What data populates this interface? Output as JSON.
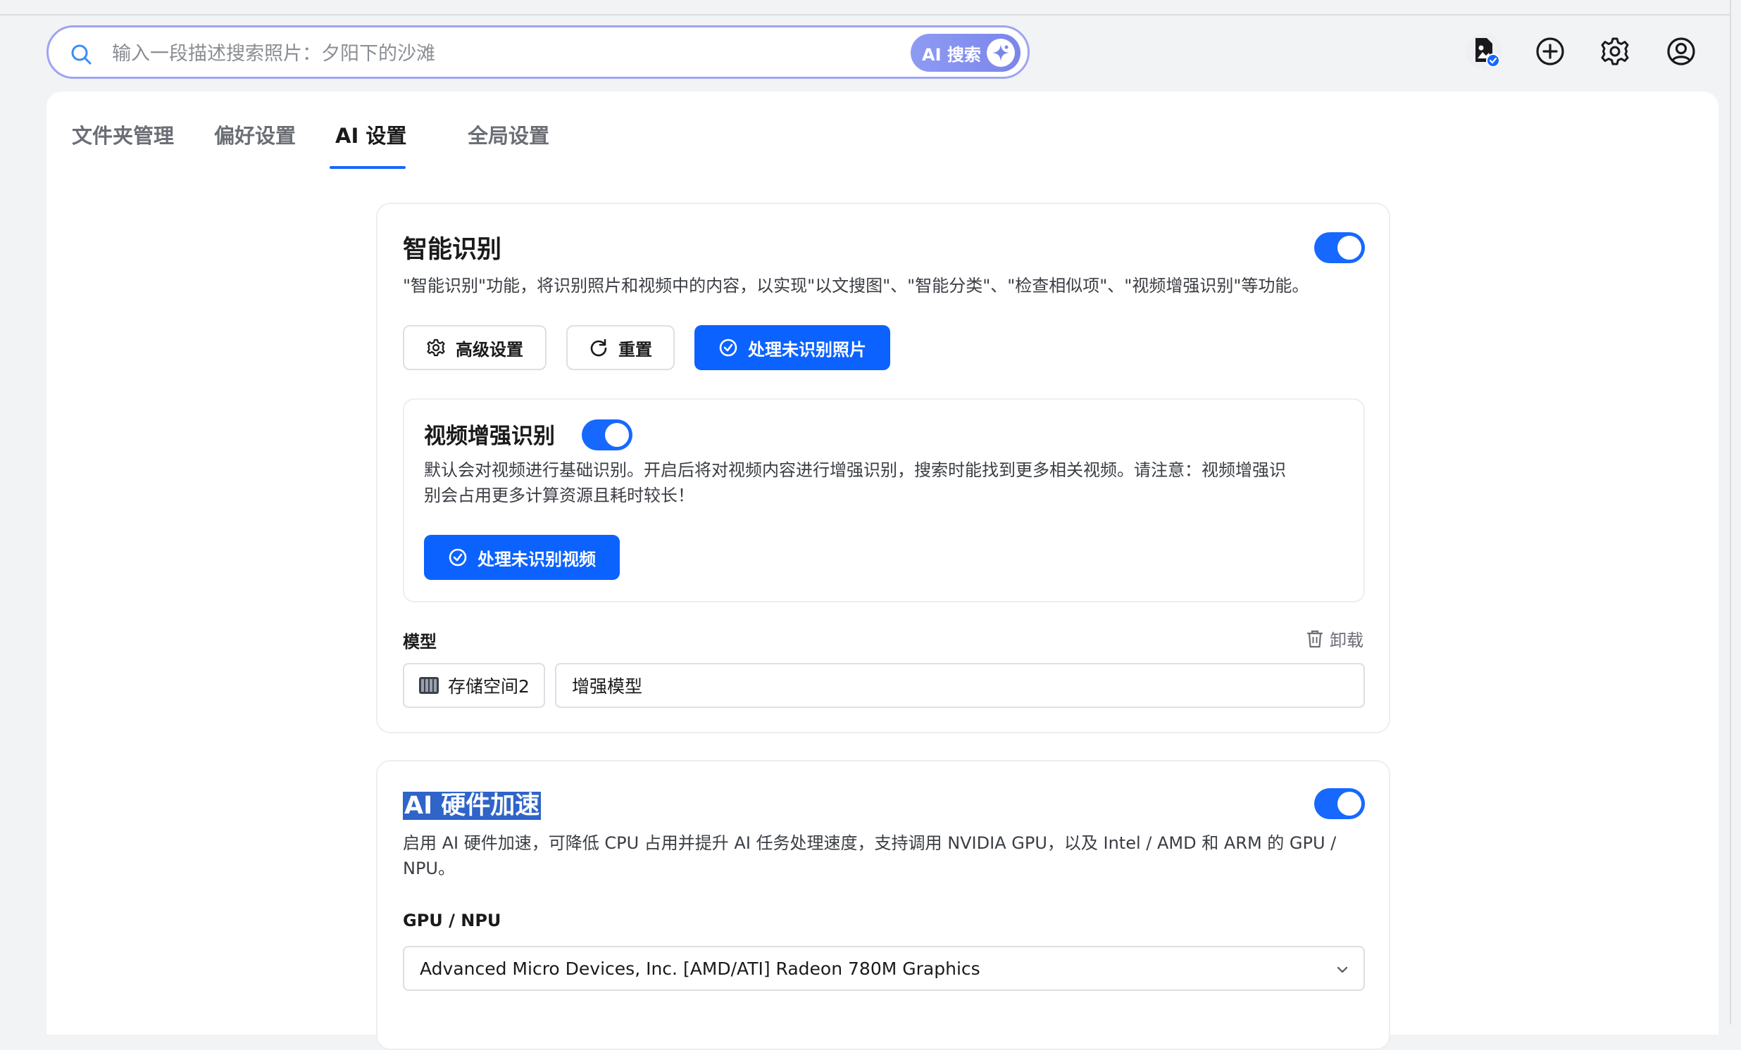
{
  "search": {
    "placeholder": "输入一段描述搜索照片：夕阳下的沙滩",
    "ai_button_label": "AI 搜索"
  },
  "topbar": {
    "icons": [
      "document-sync-icon",
      "add-circle-icon",
      "gear-icon",
      "user-avatar-icon"
    ],
    "accent": "#1668ff"
  },
  "tabs": [
    {
      "label": "文件夹管理",
      "active": false
    },
    {
      "label": "偏好设置",
      "active": false
    },
    {
      "label": "AI 设置",
      "active": true
    },
    {
      "label": "全局设置",
      "active": false
    }
  ],
  "smart_recognition": {
    "title": "智能识别",
    "enabled": true,
    "description": "\"智能识别\"功能，将识别照片和视频中的内容，以实现\"以文搜图\"、\"智能分类\"、\"检查相似项\"、\"视频增强识别\"等功能。",
    "advanced_button": "高级设置",
    "reset_button": "重置",
    "process_photos_button": "处理未识别照片",
    "video": {
      "title": "视频增强识别",
      "enabled": true,
      "description_line1": "默认会对视频进行基础识别。开启后将对视频内容进行增强识别，搜索时能找到更多相关视频。请注意：视频增强识",
      "description_line2": "别会占用更多计算资源且耗时较长！",
      "process_button": "处理未识别视频"
    },
    "model": {
      "label": "模型",
      "uninstall_label": "卸载",
      "storage": "存储空间2",
      "model_name": "增强模型"
    }
  },
  "hardware_accel": {
    "title": "AI 硬件加速",
    "enabled": true,
    "description_line1": "启用 AI 硬件加速，可降低 CPU 占用并提升 AI 任务处理速度，支持调用 NVIDIA GPU，以及 Intel / AMD 和 ARM 的 GPU /",
    "description_line2": "NPU。",
    "gpu_label": "GPU / NPU",
    "gpu_selected": "Advanced Micro Devices, Inc. [AMD/ATI] Radeon 780M Graphics"
  }
}
